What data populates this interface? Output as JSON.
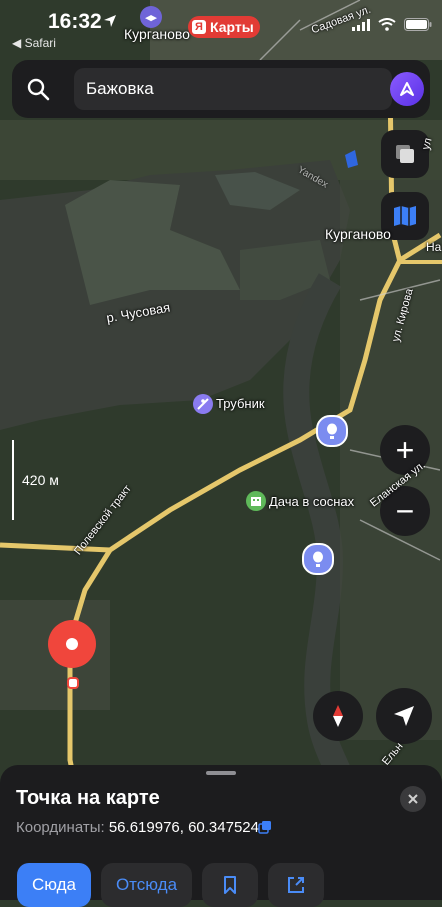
{
  "status_bar": {
    "time": "16:32",
    "back_label": "◀ Safari",
    "island_label": "Курганово",
    "yandex_label": "Карты"
  },
  "search": {
    "value": "Бажовка"
  },
  "map": {
    "place_labels": {
      "kurganovo": "Курганово",
      "river": "р. Чусовая",
      "trubnik": "Трубник",
      "dacha": "Дача в соснах",
      "road": "Полевской тракт",
      "street_kirova": "ул. Кирова",
      "street_sadovaya": "Садовая ул.",
      "street_elanskaya": "Еланская ул.",
      "street_yelny": "Ельн",
      "top_street": "ул",
      "right_edge": "На",
      "lake_label": "Yandex"
    },
    "scale_label": "420 м",
    "colors": {
      "forest": "#2f3a2c",
      "water": "#3a3f38",
      "road": "#e5c76b",
      "pin": "#f0463c",
      "poi_purple": "#8a7bf0",
      "poi_green": "#5fb95a"
    }
  },
  "controls": {
    "zoom_in": "+",
    "zoom_out": "−"
  },
  "sheet": {
    "title": "Точка на карте",
    "coords_label": "Координаты:",
    "coords_value": "56.619976, 60.347524",
    "buttons": {
      "to": "Сюда",
      "from": "Отсюда"
    }
  }
}
